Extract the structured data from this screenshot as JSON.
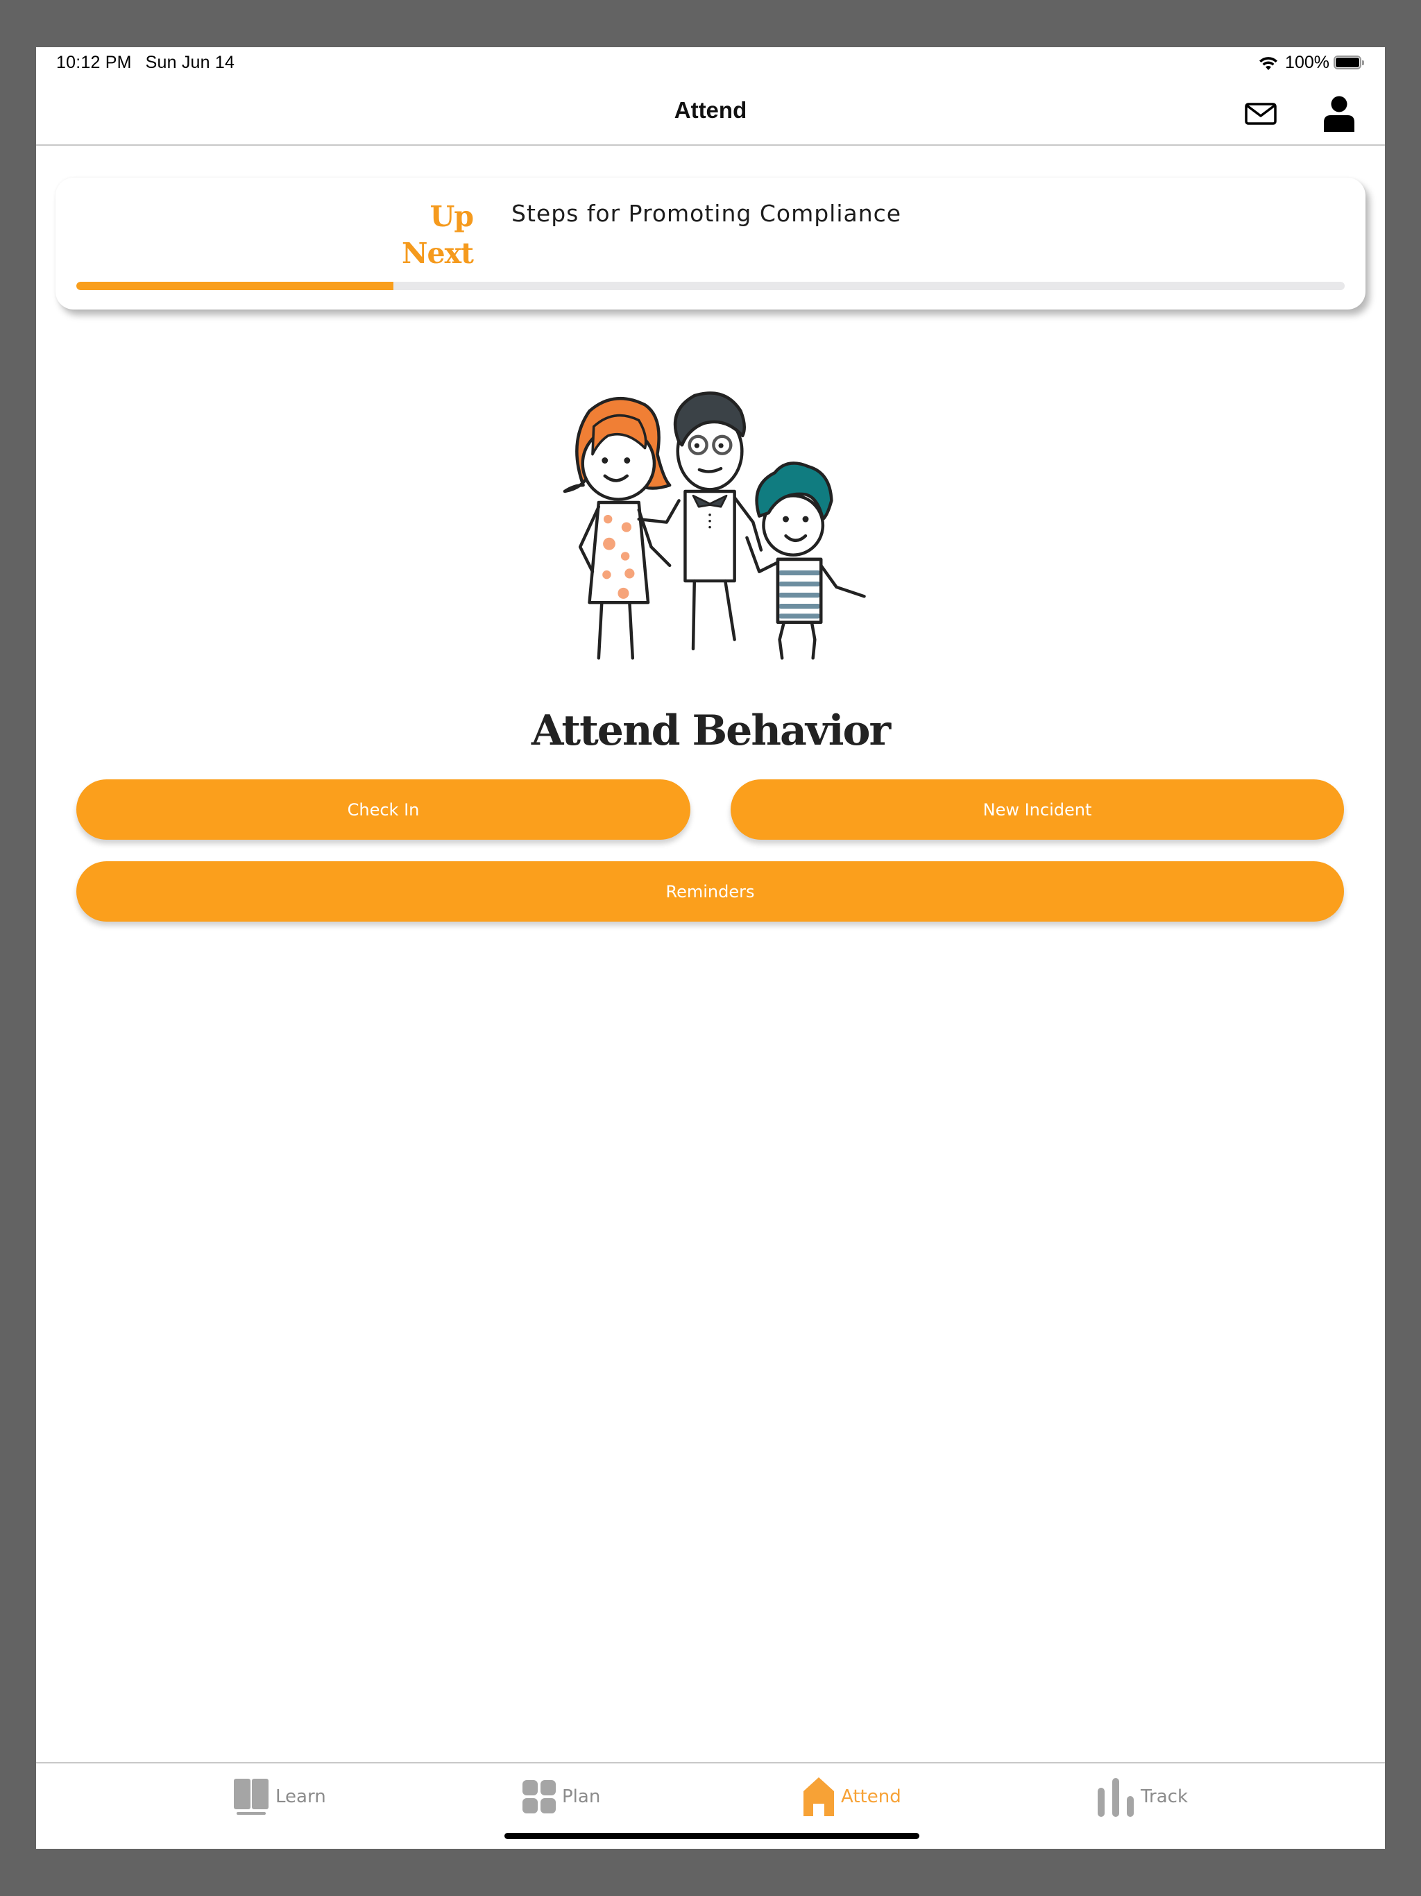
{
  "status_bar": {
    "time": "10:12 PM",
    "date": "Sun Jun 14",
    "battery": "100%",
    "icons": [
      "wifi-icon",
      "battery-icon"
    ]
  },
  "navbar": {
    "title": "Attend",
    "actions": [
      {
        "name": "mail",
        "icon": "mail-icon"
      },
      {
        "name": "profile",
        "icon": "person-icon"
      }
    ]
  },
  "up_next": {
    "label_line1": "Up",
    "label_line2": "Next",
    "title": "Steps for Promoting Compliance",
    "progress_percent": 25
  },
  "illustration": {
    "description": "family-illustration",
    "colors": {
      "mother_hair": "#f07f35",
      "father_hair": "#3b4247",
      "child_hair": "#107c80",
      "dots": "#f6a47a",
      "stripes": "#6d8ea0"
    }
  },
  "main": {
    "heading": "Attend Behavior",
    "buttons": {
      "check_in": "Check In",
      "new_incident": "New Incident",
      "reminders": "Reminders"
    }
  },
  "tabbar": {
    "tabs": [
      {
        "label": "Learn",
        "icon": "book-icon",
        "active": false
      },
      {
        "label": "Plan",
        "icon": "grid-icon",
        "active": false
      },
      {
        "label": "Attend",
        "icon": "home-icon",
        "active": true
      },
      {
        "label": "Track",
        "icon": "bar-chart-icon",
        "active": false
      }
    ]
  },
  "colors": {
    "accent": "#fb9f1c",
    "accent_text": "#f59a1d",
    "inactive_tab": "#8c8c8c",
    "progress_track": "#e8e8ea"
  }
}
